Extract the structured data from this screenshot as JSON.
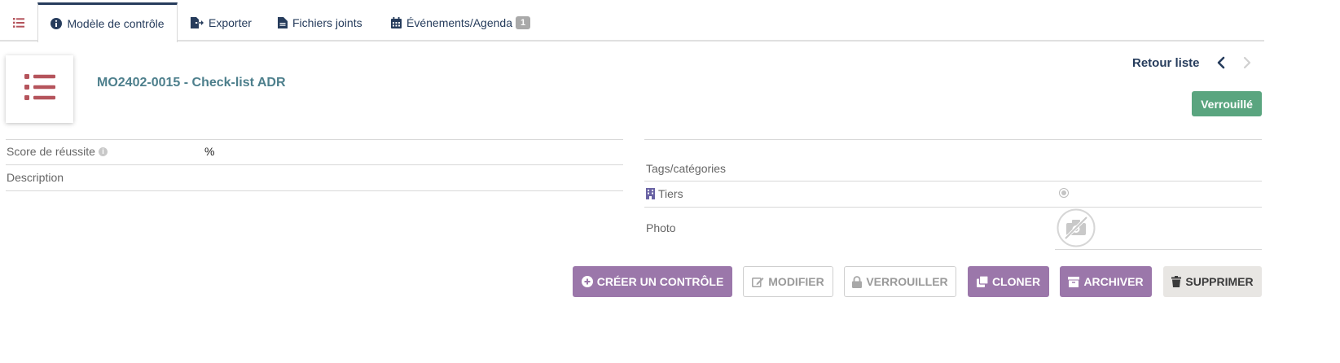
{
  "tabs": {
    "list_icon": "list-icon",
    "modele": "Modèle de contrôle",
    "exporter": "Exporter",
    "fichiers": "Fichiers joints",
    "agenda": "Événements/Agenda",
    "agenda_count": "1"
  },
  "header": {
    "ref": "MO2402-0015 - Check-list ADR",
    "retour": "Retour liste",
    "status": "Verrouillé"
  },
  "fields_left": {
    "score_label": "Score de réussite",
    "score_value": "%",
    "description_label": "Description"
  },
  "fields_right": {
    "tags_label": "Tags/catégories",
    "tiers_label": "Tiers",
    "photo_label": "Photo"
  },
  "actions": {
    "creer": "Créer un contrôle",
    "modifier": "Modifier",
    "verrouiller": "Verrouiller",
    "cloner": "Cloner",
    "archiver": "Archiver",
    "supprimer": "Supprimer"
  },
  "colors": {
    "primary": "#263c5c",
    "accent_purple": "#9b77aa",
    "status_green": "#5aa57f",
    "title_teal": "#4d7f8c",
    "icon_red": "#b5545c"
  }
}
